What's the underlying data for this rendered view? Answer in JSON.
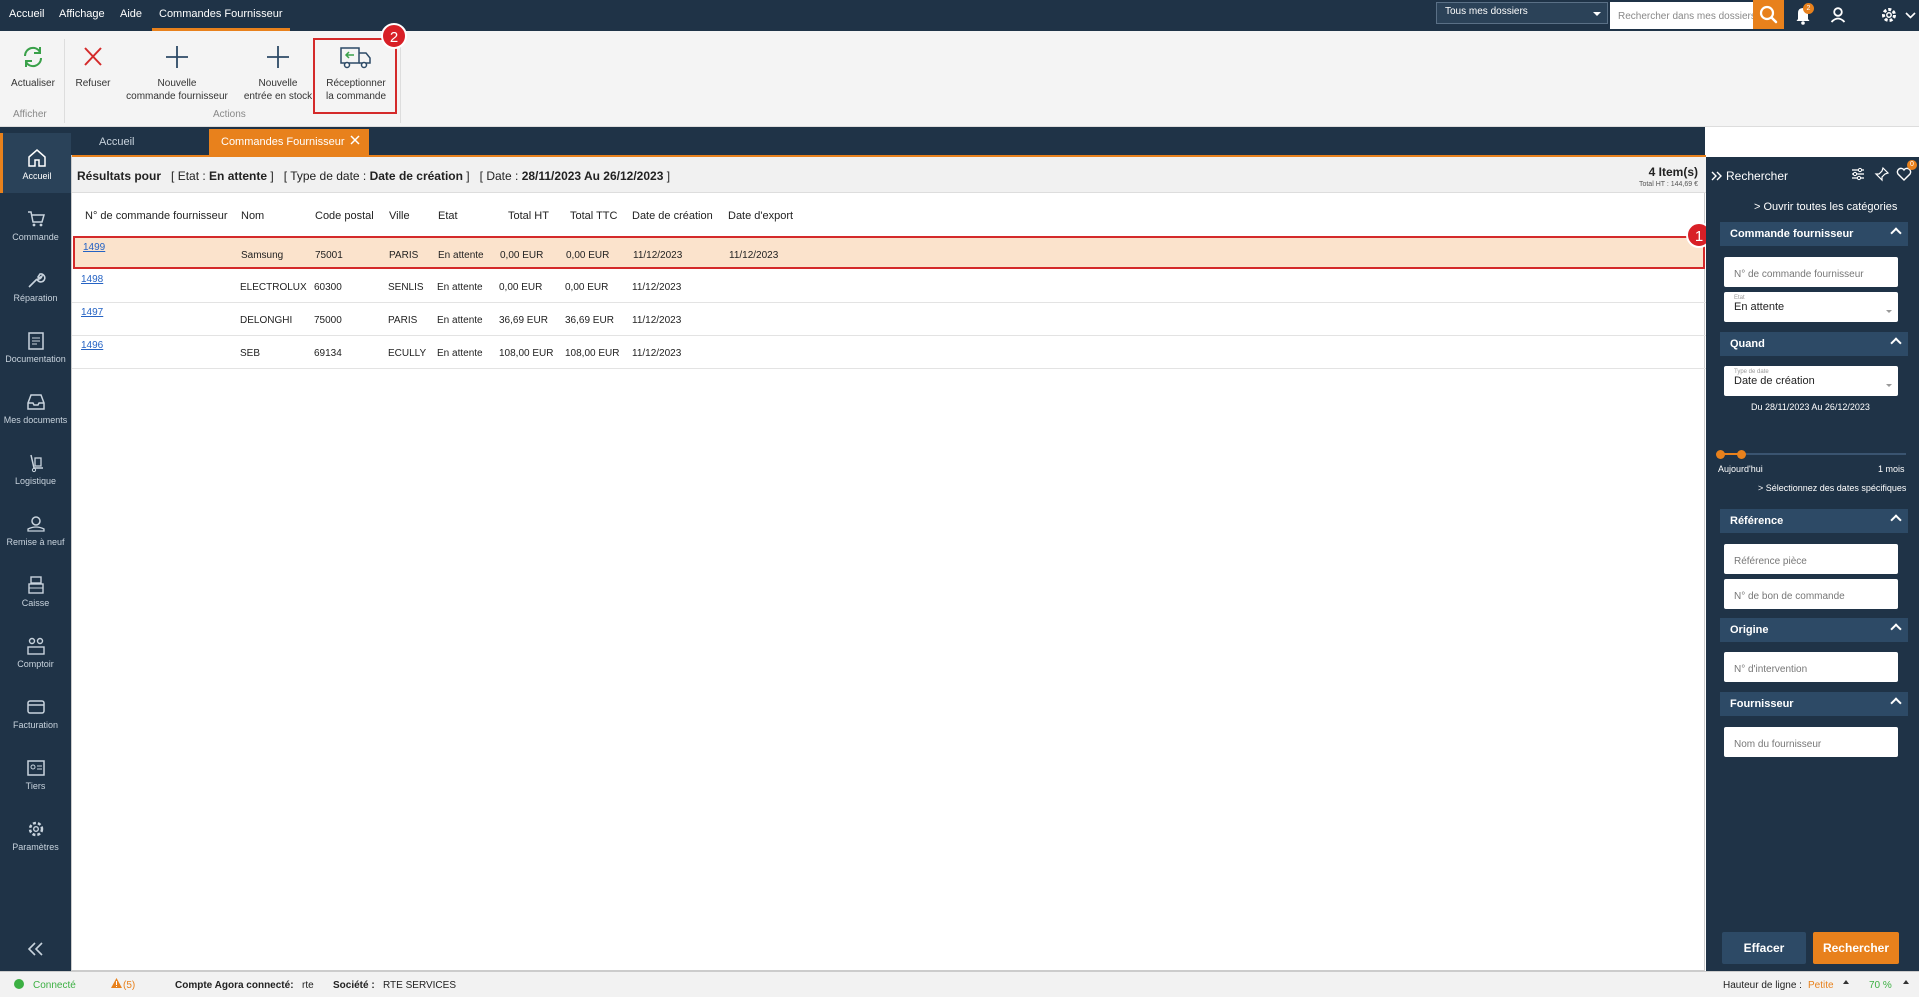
{
  "menu": {
    "items": [
      "Accueil",
      "Affichage",
      "Aide",
      "Commandes Fournisseur"
    ],
    "folder_select": "Tous mes dossiers",
    "search_placeholder": "Rechercher dans mes dossiers",
    "notification_count": "2"
  },
  "ribbon": {
    "refresh": "Actualiser",
    "refuse": "Refuser",
    "new_order_1": "Nouvelle",
    "new_order_2": "commande fournisseur",
    "new_entry_1": "Nouvelle",
    "new_entry_2": "entrée en stock",
    "receive_1": "Réceptionner",
    "receive_2": "la commande",
    "group_display": "Afficher",
    "group_actions": "Actions"
  },
  "annotations": {
    "one": "1",
    "two": "2"
  },
  "sidebar": {
    "items": [
      "Accueil",
      "Commande",
      "Réparation",
      "Documentation",
      "Mes documents",
      "Logistique",
      "Remise à neuf",
      "Caisse",
      "Comptoir",
      "Facturation",
      "Tiers",
      "Paramètres"
    ]
  },
  "tabs": [
    "Accueil",
    "Commandes Fournisseur"
  ],
  "results": {
    "label": "Résultats pour",
    "etat_prefix": "[ Etat : ",
    "etat_value": "En attente",
    "etat_suffix": " ]",
    "type_prefix": "[ Type de date : ",
    "type_value": "Date de création",
    "type_suffix": " ]",
    "date_prefix": "[ Date : ",
    "date_value": "28/11/2023 Au 26/12/2023",
    "date_suffix": " ]",
    "count": "4 Item(s)",
    "total": "Total HT : 144,69 €"
  },
  "table": {
    "columns": [
      "N° de commande fournisseur",
      "Nom",
      "Code postal",
      "Ville",
      "Etat",
      "Total HT",
      "Total TTC",
      "Date de création",
      "Date d'export"
    ],
    "rows": [
      [
        "1499",
        "Samsung",
        "75001",
        "PARIS",
        "En attente",
        "0,00 EUR",
        "0,00 EUR",
        "11/12/2023",
        "11/12/2023"
      ],
      [
        "1498",
        "ELECTROLUX",
        "60300",
        "SENLIS",
        "En attente",
        "0,00 EUR",
        "0,00 EUR",
        "11/12/2023",
        ""
      ],
      [
        "1497",
        "DELONGHI",
        "75000",
        "PARIS",
        "En attente",
        "36,69 EUR",
        "36,69 EUR",
        "11/12/2023",
        ""
      ],
      [
        "1496",
        "SEB",
        "69134",
        "ECULLY",
        "En attente",
        "108,00 EUR",
        "108,00 EUR",
        "11/12/2023",
        ""
      ]
    ]
  },
  "panel": {
    "title": "Rechercher",
    "fav_count": "0",
    "open_all": "Ouvrir toutes les catégories",
    "section_order": "Commande fournisseur",
    "order_number_placeholder": "N° de commande fournisseur",
    "etat_label": "Etat",
    "etat_value": "En attente",
    "section_when": "Quand",
    "date_type_label": "Type de date",
    "date_type_value": "Date de création",
    "date_range": "Du 28/11/2023 Au 26/12/2023",
    "slider_left": "Aujourd'hui",
    "slider_right": "1 mois",
    "specific_dates": "> Sélectionnez des dates spécifiques",
    "section_reference": "Référence",
    "ref_piece_placeholder": "Référence pièce",
    "po_number_placeholder": "N° de bon de commande",
    "section_origin": "Origine",
    "intervention_placeholder": "N° d'intervention",
    "section_supplier": "Fournisseur",
    "supplier_placeholder": "Nom du fournisseur",
    "clear_button": "Effacer",
    "search_button": "Rechercher"
  },
  "status": {
    "connected": "Connecté",
    "warnings": "(5)",
    "account_label": "Compte Agora connecté:",
    "account_value": "rte",
    "company_label": "Société :",
    "company_value": "RTE SERVICES",
    "line_height_label": "Hauteur de ligne :",
    "line_height_value": "Petite",
    "zoom": "70 %"
  },
  "colors": {
    "navy": "#1f3347",
    "accent": "#e8811c",
    "highlight": "#d42a2a",
    "link": "#2563c4",
    "connected": "#3cb043"
  }
}
